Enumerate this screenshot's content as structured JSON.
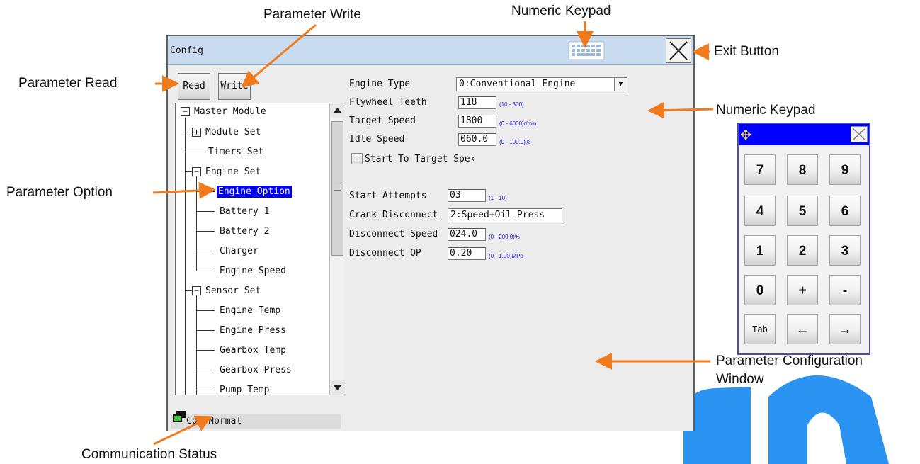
{
  "annotations": {
    "parameter_write": "Parameter Write",
    "numeric_keypad_top": "Numeric Keypad",
    "exit_button": "Exit Button",
    "parameter_read": "Parameter Read",
    "numeric_keypad_right": "Numeric Keypad",
    "parameter_option": "Parameter Option",
    "config_window_line1": "Parameter Configuration",
    "config_window_line2": "Window",
    "communication_status": "Communication Status"
  },
  "window": {
    "title": "Config"
  },
  "toolbar": {
    "read_label": "Read",
    "write_label": "Write"
  },
  "tree": {
    "items": [
      {
        "label": "Master Module",
        "expander": "−"
      },
      {
        "label": "Module Set",
        "expander": "+"
      },
      {
        "label": "Timers Set"
      },
      {
        "label": "Engine Set",
        "expander": "−"
      },
      {
        "label": "Engine Option",
        "selected": true
      },
      {
        "label": "Battery 1"
      },
      {
        "label": "Battery 2"
      },
      {
        "label": "Charger"
      },
      {
        "label": "Engine Speed"
      },
      {
        "label": "Sensor Set",
        "expander": "−"
      },
      {
        "label": "Engine Temp"
      },
      {
        "label": "Engine Press"
      },
      {
        "label": "Gearbox Temp"
      },
      {
        "label": "Gearbox Press"
      },
      {
        "label": "Pump Temp"
      }
    ]
  },
  "status": {
    "text": "Com Normal"
  },
  "config": {
    "engine_type": {
      "label": "Engine Type",
      "value": "0:Conventional Engine"
    },
    "flywheel_teeth": {
      "label": "Flywheel Teeth",
      "value": "118",
      "range": "(10 - 300)"
    },
    "target_speed": {
      "label": "Target Speed",
      "value": "1800",
      "range": "(0 - 6000)r/min"
    },
    "idle_speed": {
      "label": "Idle Speed",
      "value": "060.0",
      "range": "(0 - 100.0)%"
    },
    "start_to_target": {
      "label": "Start To Target Spe‹",
      "checked": false
    },
    "start_attempts": {
      "label": "Start Attempts",
      "value": "03",
      "range": "(1 - 10)"
    },
    "crank_disconnect": {
      "label": "Crank Disconnect",
      "value": "2:Speed+Oil Press"
    },
    "disconnect_speed": {
      "label": "Disconnect Speed",
      "value": "024.0",
      "range": "(0 - 200.0)%"
    },
    "disconnect_op": {
      "label": "Disconnect OP",
      "value": "0.20",
      "range": "(0 - 1.00)MPa"
    }
  },
  "keypad": {
    "keys": [
      "7",
      "8",
      "9",
      "4",
      "5",
      "6",
      "1",
      "2",
      "3",
      "0",
      "+",
      "-",
      "Tab",
      "←",
      "→"
    ]
  },
  "colors": {
    "selection": "#0000ee",
    "keypad_header": "#0000ff",
    "titlebar": "#c9dbee",
    "annotation_arrow": "#f07a1c",
    "watermark": "#1c8cf0"
  }
}
